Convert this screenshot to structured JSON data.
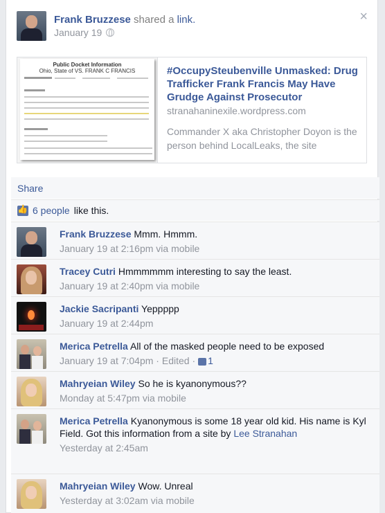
{
  "post": {
    "author": "Frank Bruzzese",
    "action": " shared a ",
    "action_link": "link.",
    "time": "January 19",
    "close": "×"
  },
  "share": {
    "doc_title": "Public Docket Information",
    "doc_sub": "Ohio, State of VS. FRANK C FRANCIS",
    "title": "#OccupySteubenville Unmasked: Drug Trafficker Frank Francis May Have Grudge Against Prosecutor",
    "domain": "stranahaninexile.wordpress.com",
    "description": "Commander X aka Christopher Doyon is the person behind LocalLeaks, the site"
  },
  "actions": {
    "share_label": "Share"
  },
  "likes": {
    "count_text": "6 people",
    "suffix": " like this."
  },
  "comments": [
    {
      "name": "Frank Bruzzese",
      "text": " Mmm. Hmmm.",
      "meta": "January 19 at 2:16pm via mobile"
    },
    {
      "name": "Tracey Cutri",
      "text": " Hmmmmmm interesting to say the least.",
      "meta": "January 19 at 2:40pm via mobile"
    },
    {
      "name": "Jackie Sacripanti",
      "text": " Yeppppp",
      "meta": "January 19 at 2:44pm"
    },
    {
      "name": "Merica Petrella",
      "text": " All of the masked people need to be exposed",
      "meta": "January 19 at 7:04pm · Edited ·",
      "likes": "1"
    },
    {
      "name": "Mahryeian Wiley",
      "text": " So he is kyanonymous??",
      "meta": "Monday at 5:47pm via mobile"
    },
    {
      "name": "Merica Petrella",
      "text": " Kyanonymous is some 18 year old kid. His name is Kyl Field. Got this information from a site by ",
      "link": "Lee Stranahan",
      "meta": "Yesterday at 2:45am"
    },
    {
      "name": "Mahryeian Wiley",
      "text": " Wow. Unreal",
      "meta": "Yesterday at 3:02am via mobile"
    }
  ],
  "colors": {
    "link": "#3b5998",
    "meta": "#90949c",
    "bar": "#f6f7f9"
  }
}
